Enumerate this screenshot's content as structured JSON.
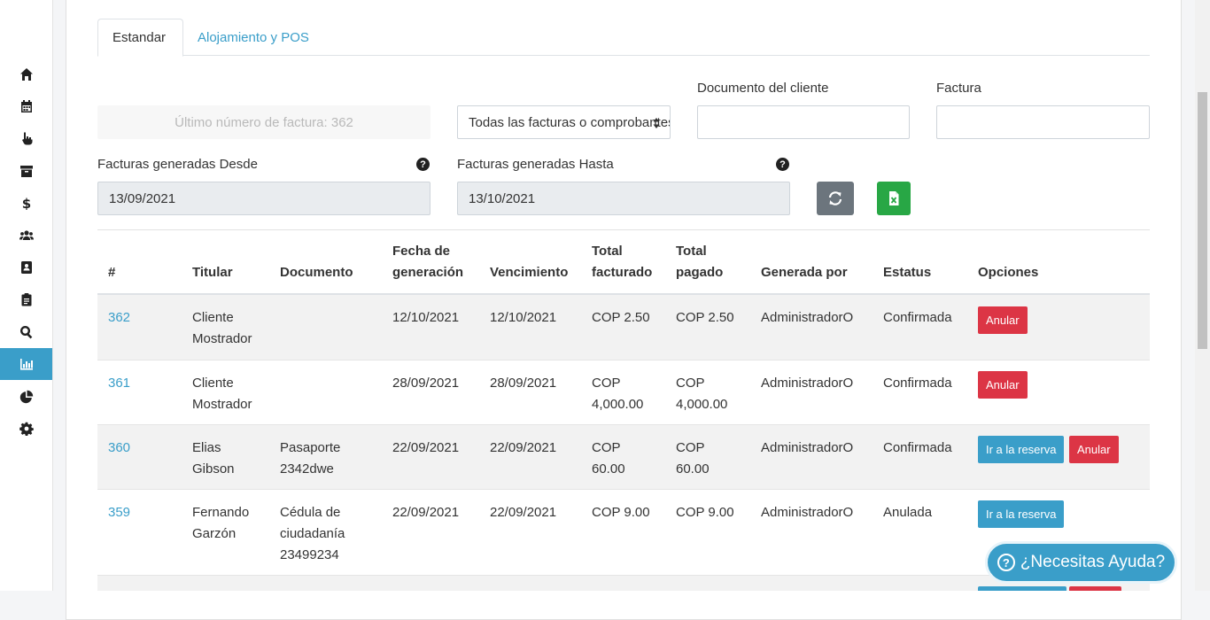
{
  "sidebar": {
    "items": [
      {
        "icon": "home-icon"
      },
      {
        "icon": "calendar-icon"
      },
      {
        "icon": "hand-pointer-icon"
      },
      {
        "icon": "archive-icon"
      },
      {
        "icon": "dollar-icon"
      },
      {
        "icon": "users-icon"
      },
      {
        "icon": "address-book-icon"
      },
      {
        "icon": "clipboard-icon"
      },
      {
        "icon": "search-icon"
      },
      {
        "icon": "bar-chart-icon",
        "active": true
      },
      {
        "icon": "pie-chart-icon"
      },
      {
        "icon": "gear-icon"
      }
    ]
  },
  "tabs": {
    "standard": "Estandar",
    "lodging": "Alojamiento y POS"
  },
  "filters": {
    "invoice_number": "Último número de factura: 362",
    "type_select": "Todas las facturas o comprobantes",
    "client_doc_label": "Documento del cliente",
    "client_doc_value": "",
    "invoice_label": "Factura",
    "invoice_value": "",
    "from_label": "Facturas generadas Desde",
    "from_value": "13/09/2021",
    "to_label": "Facturas generadas Hasta",
    "to_value": "13/10/2021",
    "help_glyph": "?"
  },
  "table": {
    "headers": {
      "num": "#",
      "holder": "Titular",
      "document": "Documento",
      "generated_l1": "Fecha de",
      "generated_l2": "generación",
      "due": "Vencimiento",
      "billed_l1": "Total",
      "billed_l2": "facturado",
      "paid_l1": "Total",
      "paid_l2": "pagado",
      "by": "Generada por",
      "status": "Estatus",
      "options": "Opciones"
    },
    "rows": [
      {
        "num": "362",
        "holder_l1": "Cliente",
        "holder_l2": "Mostrador",
        "doc_l1": "",
        "doc_l2": "",
        "doc_l3": "",
        "generated": "12/10/2021",
        "due": "12/10/2021",
        "billed_l1": "COP 2.50",
        "billed_l2": "",
        "paid_l1": "COP 2.50",
        "paid_l2": "",
        "by": "AdministradorO",
        "status": "Confirmada",
        "goto": "",
        "cancel": "Anular"
      },
      {
        "num": "361",
        "holder_l1": "Cliente",
        "holder_l2": "Mostrador",
        "doc_l1": "",
        "doc_l2": "",
        "doc_l3": "",
        "generated": "28/09/2021",
        "due": "28/09/2021",
        "billed_l1": "COP",
        "billed_l2": "4,000.00",
        "paid_l1": "COP",
        "paid_l2": "4,000.00",
        "by": "AdministradorO",
        "status": "Confirmada",
        "goto": "",
        "cancel": "Anular"
      },
      {
        "num": "360",
        "holder_l1": "Elias",
        "holder_l2": "Gibson",
        "doc_l1": "Pasaporte",
        "doc_l2": "2342dwe",
        "doc_l3": "",
        "generated": "22/09/2021",
        "due": "22/09/2021",
        "billed_l1": "COP",
        "billed_l2": "60.00",
        "paid_l1": "COP",
        "paid_l2": "60.00",
        "by": "AdministradorO",
        "status": "Confirmada",
        "goto": "Ir a la reserva",
        "cancel": "Anular"
      },
      {
        "num": "359",
        "holder_l1": "Fernando",
        "holder_l2": "Garzón",
        "doc_l1": "Cédula de",
        "doc_l2": "ciudadanía",
        "doc_l3": "23499234",
        "generated": "22/09/2021",
        "due": "22/09/2021",
        "billed_l1": "COP 9.00",
        "billed_l2": "",
        "paid_l1": "COP 9.00",
        "paid_l2": "",
        "by": "AdministradorO",
        "status": "Anulada",
        "goto": "Ir a la reserva",
        "cancel": ""
      }
    ]
  },
  "help_widget": {
    "glyph": "?",
    "label": "¿Necesitas Ayuda?"
  },
  "colors": {
    "accent": "#3a9ec9",
    "danger": "#dc3545",
    "success": "#28a745",
    "secondary": "#6c757d"
  }
}
